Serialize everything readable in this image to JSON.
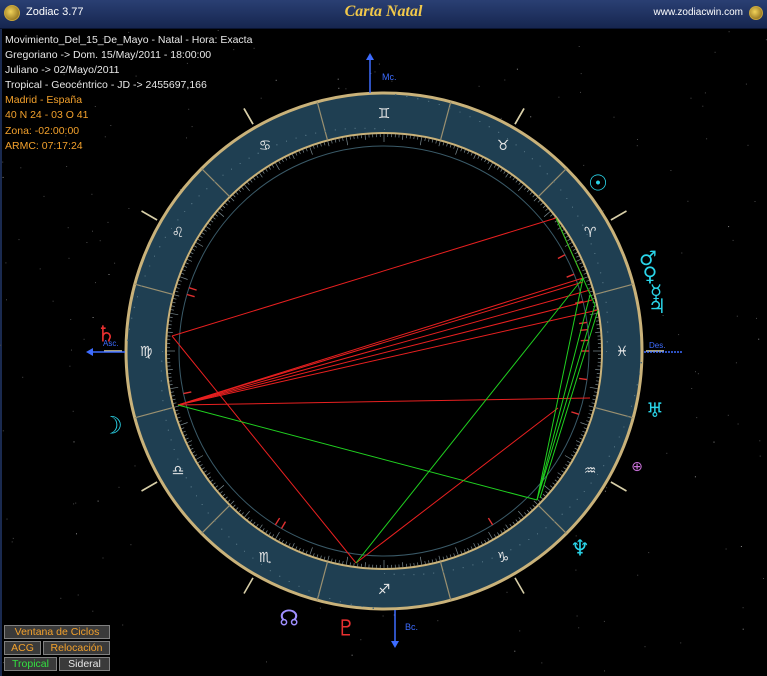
{
  "titlebar": {
    "app_name": "Zodiac 3.77",
    "window_title": "Carta Natal",
    "website": "www.zodiacwin.com"
  },
  "info_lines": [
    {
      "text": "Movimiento_Del_15_De_Mayo - Natal - Hora: Exacta",
      "color": "white"
    },
    {
      "text": "Gregoriano -> Dom. 15/May/2011 - 18:00:00",
      "color": "white"
    },
    {
      "text": "Juliano -> 02/Mayo/2011",
      "color": "white"
    },
    {
      "text": "Tropical - Geocéntrico - JD -> 2455697,166",
      "color": "white"
    },
    {
      "text": "Madrid - España",
      "color": "orange"
    },
    {
      "text": "40 N 24 - 03 O 41",
      "color": "orange"
    },
    {
      "text": "Zona: -02:00:00",
      "color": "orange"
    },
    {
      "text": "ARMC: 07:17:24",
      "color": "orange"
    }
  ],
  "angles": {
    "mc_label": "Mc.",
    "bc_label": "Bc.",
    "asc_label": "Asc.",
    "des_label": "Des."
  },
  "zodiac_signs": [
    {
      "name": "cancer",
      "glyph": "♋"
    },
    {
      "name": "gemini",
      "glyph": "♊"
    },
    {
      "name": "taurus",
      "glyph": "♉"
    },
    {
      "name": "aries",
      "glyph": "♈"
    },
    {
      "name": "pisces",
      "glyph": "♓"
    },
    {
      "name": "aquarius",
      "glyph": "♒"
    },
    {
      "name": "capricorn",
      "glyph": "♑"
    },
    {
      "name": "sagittarius",
      "glyph": "♐"
    },
    {
      "name": "scorpio",
      "glyph": "♏"
    },
    {
      "name": "libra",
      "glyph": "♎"
    },
    {
      "name": "virgo",
      "glyph": "♍"
    },
    {
      "name": "leo",
      "glyph": "♌"
    }
  ],
  "planets": [
    {
      "name": "sun",
      "glyph": "☉",
      "color": "#2ad4e8"
    },
    {
      "name": "mars",
      "glyph": "♂",
      "color": "#2ad4e8"
    },
    {
      "name": "venus",
      "glyph": "♀",
      "color": "#2ad4e8"
    },
    {
      "name": "mercury",
      "glyph": "☿",
      "color": "#2ad4e8"
    },
    {
      "name": "jupiter",
      "glyph": "♃",
      "color": "#2ad4e8"
    },
    {
      "name": "uranus",
      "glyph": "♅",
      "color": "#2ad4e8"
    },
    {
      "name": "part-of-fortune",
      "glyph": "⊕",
      "color": "#c870d8"
    },
    {
      "name": "neptune",
      "glyph": "♆",
      "color": "#2ad4e8"
    },
    {
      "name": "pluto",
      "glyph": "♇",
      "color": "#e83030"
    },
    {
      "name": "node",
      "glyph": "☊",
      "color": "#a090ff"
    },
    {
      "name": "moon",
      "glyph": "☽",
      "color": "#2ad4e8"
    },
    {
      "name": "saturn",
      "glyph": "♄",
      "color": "#e83030"
    }
  ],
  "buttons": {
    "cycles": "Ventana de Ciclos",
    "acg": "ACG",
    "relocation": "Relocación",
    "tropical": "Tropical",
    "sidereal": "Sideral"
  },
  "colors": {
    "wheel_ring": "#1f3f52",
    "wheel_border": "#c9b27a",
    "aspect_red": "#e82020",
    "aspect_green": "#20d020",
    "glyph_cyan": "#2ad4e8",
    "angle_arrow": "#3d6cff",
    "info_white": "#e8e8e8",
    "info_orange": "#f3a12c",
    "title_gold": "#f1c84a"
  }
}
